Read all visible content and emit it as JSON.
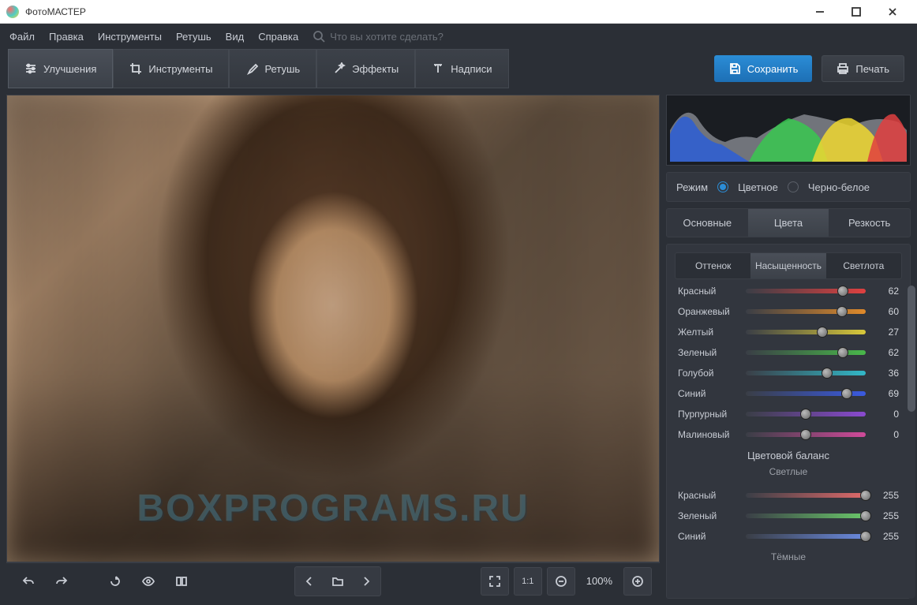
{
  "window": {
    "title": "ФотоМАСТЕР"
  },
  "menu": {
    "items": [
      "Файл",
      "Правка",
      "Инструменты",
      "Ретушь",
      "Вид",
      "Справка"
    ],
    "search_placeholder": "Что вы хотите сделать?"
  },
  "toolbar": {
    "tabs": [
      {
        "label": "Улучшения",
        "icon": "sliders"
      },
      {
        "label": "Инструменты",
        "icon": "crop"
      },
      {
        "label": "Ретушь",
        "icon": "brush"
      },
      {
        "label": "Эффекты",
        "icon": "wand"
      },
      {
        "label": "Надписи",
        "icon": "text"
      }
    ],
    "save_label": "Сохранить",
    "print_label": "Печать"
  },
  "canvas": {
    "watermark": "BOXPROGRAMS.RU"
  },
  "bottombar": {
    "zoom": "100%",
    "one_to_one": "1:1"
  },
  "panel": {
    "mode_label": "Режим",
    "mode_options": [
      "Цветное",
      "Черно-белое"
    ],
    "main_tabs": [
      "Основные",
      "Цвета",
      "Резкость"
    ],
    "sub_tabs": [
      "Оттенок",
      "Насыщенность",
      "Светлота"
    ],
    "sliders": [
      {
        "name": "Красный",
        "value": 62,
        "min": -100,
        "max": 100,
        "gradient": [
          "#3a3e46",
          "#e04040"
        ]
      },
      {
        "name": "Оранжевый",
        "value": 60,
        "min": -100,
        "max": 100,
        "gradient": [
          "#3a3e46",
          "#e08a2a"
        ]
      },
      {
        "name": "Желтый",
        "value": 27,
        "min": -100,
        "max": 100,
        "gradient": [
          "#3a3e46",
          "#d8c83a"
        ]
      },
      {
        "name": "Зеленый",
        "value": 62,
        "min": -100,
        "max": 100,
        "gradient": [
          "#3a3e46",
          "#49b84a"
        ]
      },
      {
        "name": "Голубой",
        "value": 36,
        "min": -100,
        "max": 100,
        "gradient": [
          "#3a3e46",
          "#32b8c8"
        ]
      },
      {
        "name": "Синий",
        "value": 69,
        "min": -100,
        "max": 100,
        "gradient": [
          "#3a3e46",
          "#3a5ae0"
        ]
      },
      {
        "name": "Пурпурный",
        "value": 0,
        "min": -100,
        "max": 100,
        "gradient": [
          "#3a3e46",
          "#8a4ad0"
        ]
      },
      {
        "name": "Малиновый",
        "value": 0,
        "min": -100,
        "max": 100,
        "gradient": [
          "#3a3e46",
          "#d04a9a"
        ]
      }
    ],
    "balance_title": "Цветовой баланс",
    "balance_light": "Светлые",
    "balance_dark": "Тёмные",
    "balance_sliders": [
      {
        "name": "Красный",
        "value": 255,
        "min": 0,
        "max": 255,
        "gradient": [
          "#3a3e46",
          "#e06a6a"
        ]
      },
      {
        "name": "Зеленый",
        "value": 255,
        "min": 0,
        "max": 255,
        "gradient": [
          "#3a3e46",
          "#6ac86a"
        ]
      },
      {
        "name": "Синий",
        "value": 255,
        "min": 0,
        "max": 255,
        "gradient": [
          "#3a3e46",
          "#6a8ae0"
        ]
      }
    ]
  }
}
